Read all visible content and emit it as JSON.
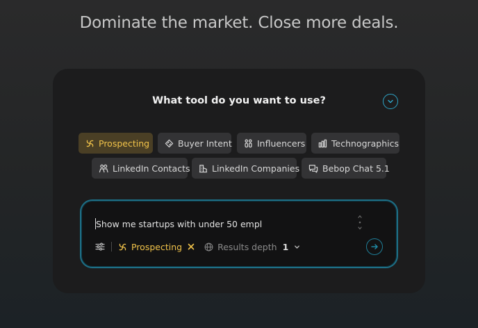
{
  "headline": "Dominate the market. Close more deals.",
  "card": {
    "question": "What tool do you want to use?",
    "collapse_icon": "chevron-down-icon"
  },
  "tools": [
    {
      "label": "Prospecting",
      "icon": "prospecting-swirl-icon",
      "active": true
    },
    {
      "label": "Buyer Intent",
      "icon": "diamond-icon",
      "active": false
    },
    {
      "label": "Influencers",
      "icon": "influencers-icon",
      "active": false
    },
    {
      "label": "Technographics",
      "icon": "bar-chart-icon",
      "active": false
    },
    {
      "label": "LinkedIn Contacts",
      "icon": "people-icon",
      "active": false
    },
    {
      "label": "LinkedIn Companies",
      "icon": "company-icon",
      "active": false
    },
    {
      "label": "Bebop Chat 5.1",
      "icon": "chat-bubbles-icon",
      "active": false
    }
  ],
  "input": {
    "value": "Show me startups with under 50 empl",
    "selected_tool": "Prospecting",
    "depth_label": "Results depth",
    "depth_value": "1"
  },
  "colors": {
    "accent_gold": "#f1c34a",
    "accent_teal": "#2fa4c6",
    "card_bg": "#1c1c1d",
    "chip_bg": "#333335"
  }
}
